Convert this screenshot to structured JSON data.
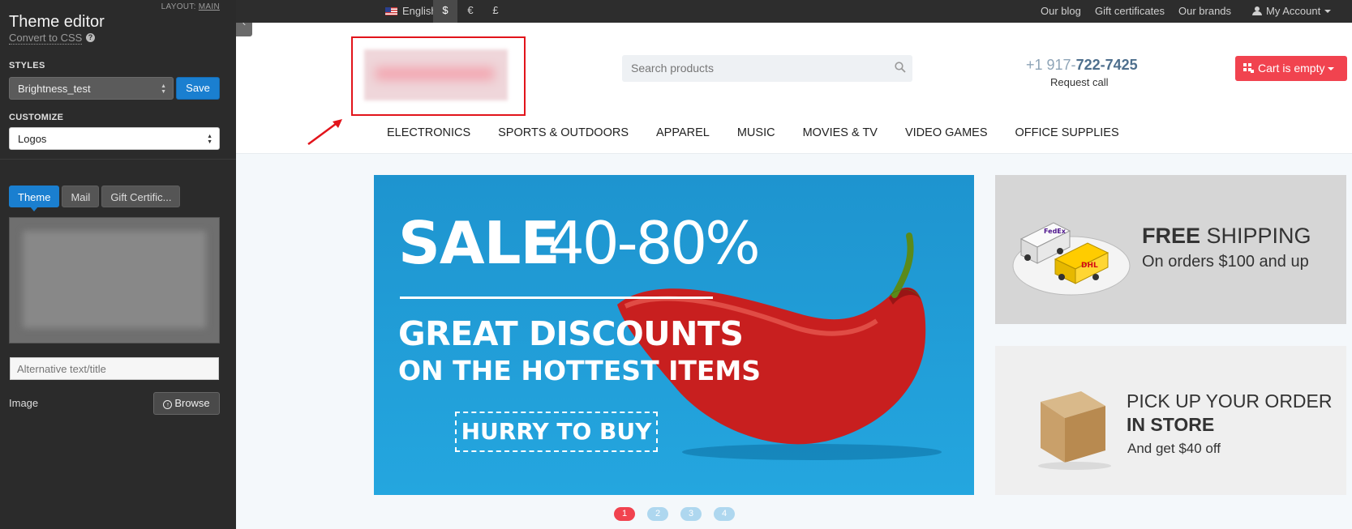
{
  "editor": {
    "title": "Theme editor",
    "layout_label": "LAYOUT:",
    "layout_value": "MAIN",
    "convert_link": "Convert to CSS",
    "styles_label": "STYLES",
    "styles_value": "Brightness_test",
    "save_label": "Save",
    "customize_label": "CUSTOMIZE",
    "customize_value": "Logos",
    "tabs": [
      "Theme",
      "Mail",
      "Gift Certific..."
    ],
    "alt_placeholder": "Alternative text/title",
    "image_label": "Image",
    "browse_label": "Browse",
    "collapse_glyph": "‹"
  },
  "topbar": {
    "language": "English",
    "currencies": [
      "$",
      "€",
      "£"
    ],
    "active_currency": "$",
    "links": [
      "Our blog",
      "Gift certificates",
      "Our brands"
    ],
    "account": "My Account"
  },
  "header": {
    "search_placeholder": "Search products",
    "phone_prefix": "+1 917-",
    "phone_main": "722-7425",
    "request_call": "Request call",
    "cart_label": "Cart is empty"
  },
  "menu": [
    "ELECTRONICS",
    "SPORTS & OUTDOORS",
    "APPAREL",
    "MUSIC",
    "MOVIES & TV",
    "VIDEO GAMES",
    "OFFICE SUPPLIES"
  ],
  "banner": {
    "sale": "SALE",
    "percent": "40-80%",
    "line1": "GREAT DISCOUNTS",
    "line2": "ON THE HOTTEST ITEMS",
    "cta": "HURRY TO BUY"
  },
  "promos": {
    "shipping_bold": "FREE",
    "shipping_rest": " SHIPPING",
    "shipping_sub": "On orders $100 and up",
    "pickup_line1": "PICK UP YOUR ORDER",
    "pickup_line2": "IN STORE",
    "pickup_sub": "And get $40 off"
  },
  "pager": [
    "1",
    "2",
    "3",
    "4"
  ],
  "colors": {
    "accent_red": "#f1434f",
    "editor_blue": "#1a7fd0",
    "banner_blue": "#24a6df",
    "annotation_red": "#e2141b"
  }
}
